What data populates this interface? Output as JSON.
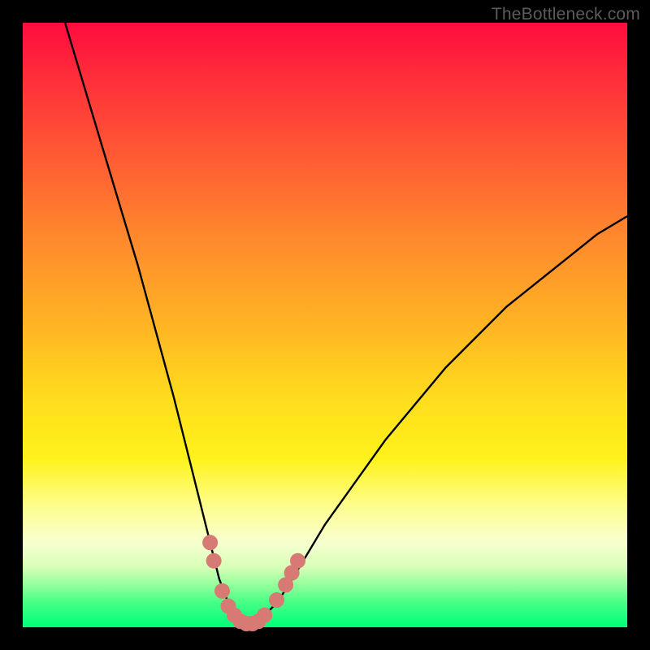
{
  "watermark": {
    "text": "TheBottleneck.com"
  },
  "chart_data": {
    "type": "line",
    "title": "",
    "xlabel": "",
    "ylabel": "",
    "xlim": [
      0,
      100
    ],
    "ylim": [
      0,
      100
    ],
    "series": [
      {
        "name": "bottleneck-curve",
        "x": [
          7,
          10,
          13,
          16,
          19,
          22,
          25,
          27,
          29,
          31,
          32.5,
          34,
          35,
          36,
          37,
          38,
          39,
          40,
          42,
          44,
          47,
          50,
          55,
          60,
          65,
          70,
          75,
          80,
          85,
          90,
          95,
          100
        ],
        "y": [
          100,
          90,
          80,
          70,
          60,
          49,
          38,
          30,
          22,
          14,
          8,
          4,
          2,
          1,
          0.5,
          0.5,
          1,
          2,
          4,
          7,
          12,
          17,
          24,
          31,
          37,
          43,
          48,
          53,
          57,
          61,
          65,
          68
        ]
      }
    ],
    "markers": {
      "name": "highlight-dots",
      "color": "#d77a74",
      "points": [
        {
          "x": 31.0,
          "y": 14
        },
        {
          "x": 31.6,
          "y": 11
        },
        {
          "x": 33.0,
          "y": 6
        },
        {
          "x": 34.0,
          "y": 3.5
        },
        {
          "x": 35.0,
          "y": 2
        },
        {
          "x": 36.0,
          "y": 1
        },
        {
          "x": 37.0,
          "y": 0.6
        },
        {
          "x": 38.0,
          "y": 0.6
        },
        {
          "x": 39.0,
          "y": 1
        },
        {
          "x": 40.0,
          "y": 2
        },
        {
          "x": 42.0,
          "y": 4.5
        },
        {
          "x": 43.5,
          "y": 7
        },
        {
          "x": 44.5,
          "y": 9
        },
        {
          "x": 45.5,
          "y": 11
        }
      ]
    },
    "gradient_stops": [
      {
        "pos": 0,
        "color": "#ff0b3f"
      },
      {
        "pos": 50,
        "color": "#ffb424"
      },
      {
        "pos": 72,
        "color": "#fff21a"
      },
      {
        "pos": 100,
        "color": "#00ff7a"
      }
    ]
  }
}
